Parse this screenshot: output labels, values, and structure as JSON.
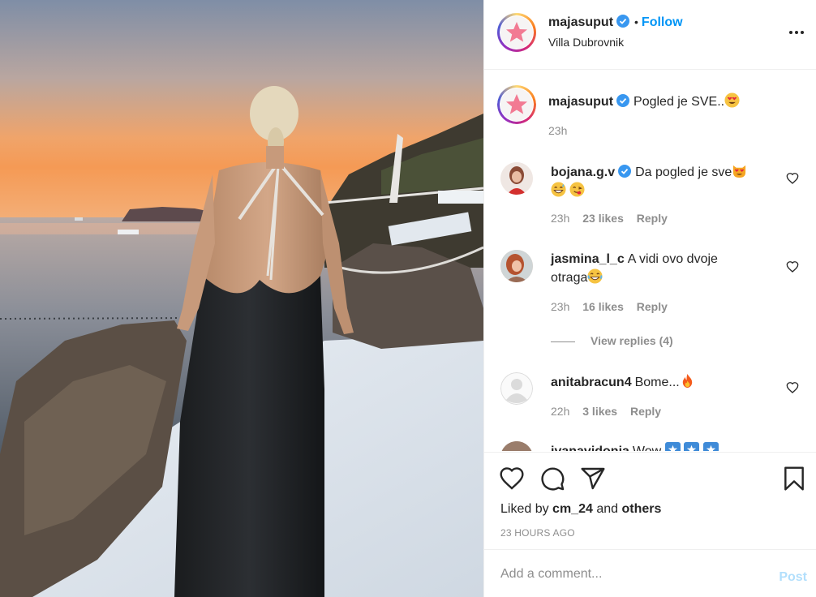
{
  "post": {
    "username": "majasuput",
    "follow_label": "Follow",
    "dot": "•",
    "location": "Villa Dubrovnik"
  },
  "caption": {
    "username": "majasuput",
    "text": "Pogled je SVE..",
    "time": "23h"
  },
  "comments": [
    {
      "username": "bojana.g.v",
      "text": "Da pogled je sve",
      "time": "23h",
      "likes": "23 likes",
      "reply": "Reply"
    },
    {
      "username": "jasmina_l_c",
      "text": "A vidi ovo dvoje otraga",
      "time": "23h",
      "likes": "16 likes",
      "reply": "Reply"
    },
    {
      "username": "anitabracun4",
      "text": "Bome...",
      "time": "22h",
      "likes": "3 likes",
      "reply": "Reply"
    },
    {
      "username": "ivanavidonja",
      "text": "Wow",
      "time": "",
      "likes": "",
      "reply": ""
    }
  ],
  "view_replies": "View replies (4)",
  "liked_by": {
    "prefix": "Liked by",
    "user": "cm_24",
    "and": "and",
    "others": "others"
  },
  "timestamp": "23 HOURS AGO",
  "add_comment": {
    "placeholder": "Add a comment...",
    "post_label": "Post"
  },
  "icons": [
    "verified-badge-icon",
    "more-options-icon",
    "heart-icon",
    "comment-icon",
    "share-icon",
    "save-bookmark-icon"
  ],
  "colors": {
    "follow": "#0095f6",
    "verified": "#3897f0",
    "post_disabled": "#b2dffc",
    "muted": "#8e8e8e"
  }
}
